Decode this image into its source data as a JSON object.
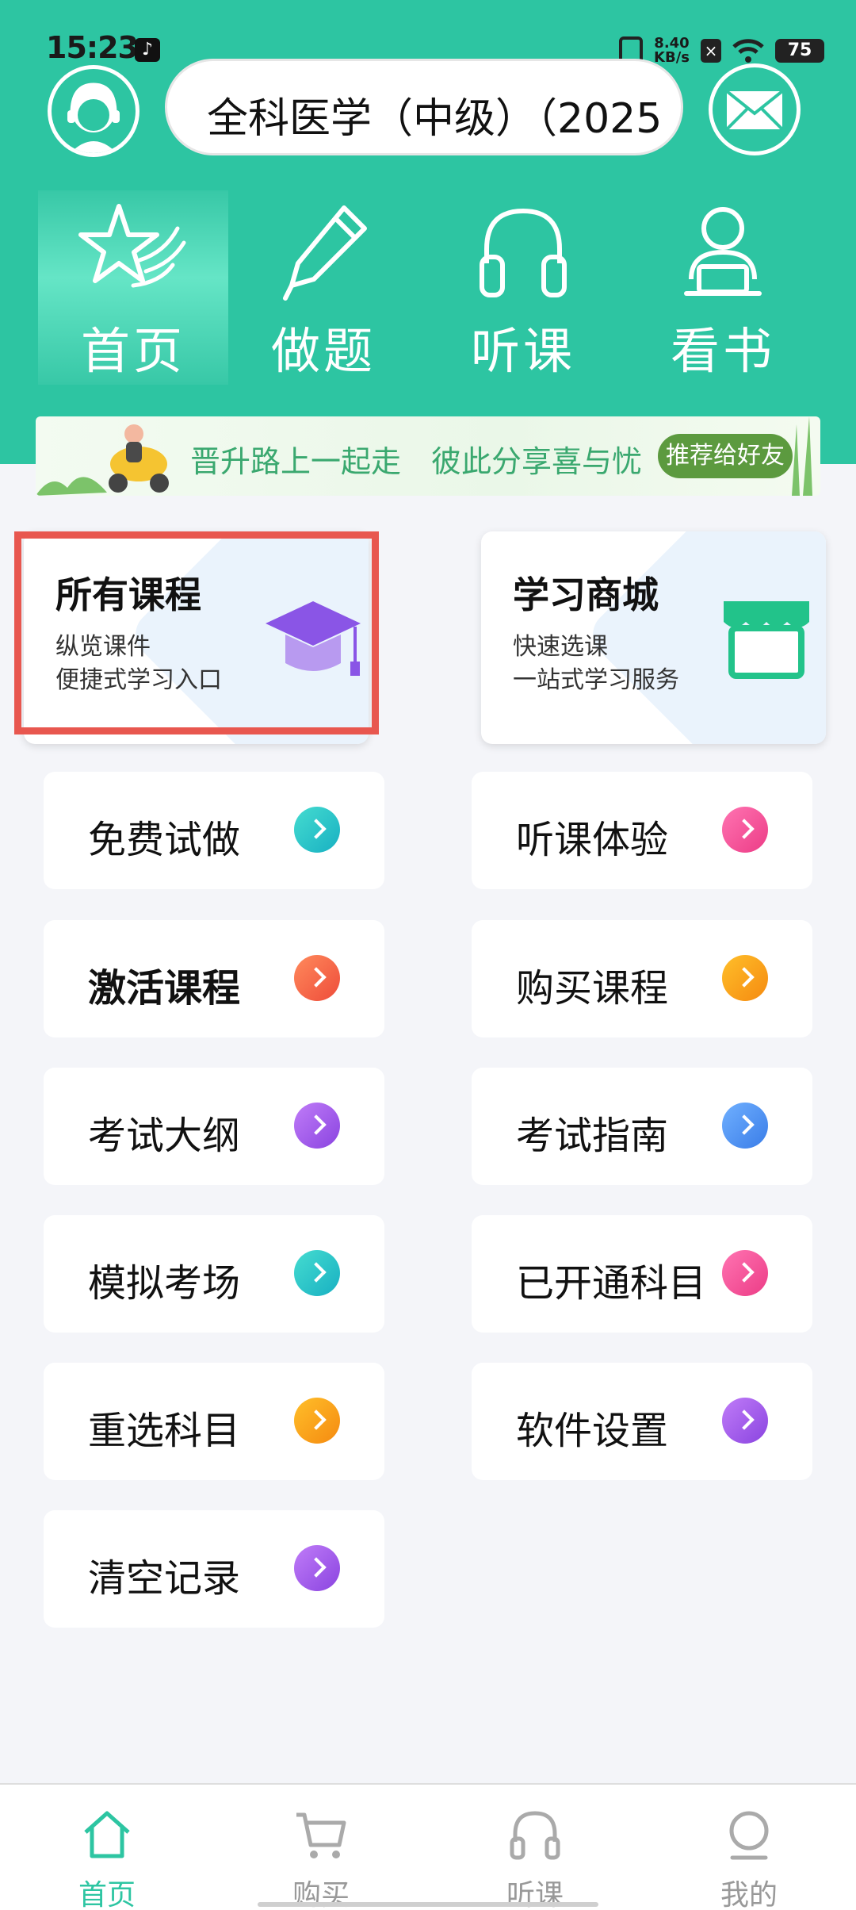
{
  "status_bar": {
    "time": "15:23",
    "tiktok_icon": "♪",
    "net_speed_value": "8.40",
    "net_speed_unit": "KB/s",
    "sim_icon": "×",
    "battery": "75"
  },
  "header": {
    "search_text": "全科医学（中级）（2025"
  },
  "top_tabs": [
    {
      "label": "首页",
      "icon": "star-icon",
      "active": true
    },
    {
      "label": "做题",
      "icon": "pencil-icon",
      "active": false
    },
    {
      "label": "听课",
      "icon": "headphones-icon",
      "active": false
    },
    {
      "label": "看书",
      "icon": "reader-icon",
      "active": false
    }
  ],
  "banner": {
    "text": "晋升路上一起走　彼此分享喜与忧",
    "button": "推荐给好友"
  },
  "big_cards": [
    {
      "title": "所有课程",
      "sub1": "纵览课件",
      "sub2": "便捷式学习入口",
      "icon": "graduation-cap-icon"
    },
    {
      "title": "学习商城",
      "sub1": "快速选课",
      "sub2": "一站式学习服务",
      "icon": "store-icon"
    }
  ],
  "menu": [
    {
      "label": "免费试做",
      "color": "#22c3c4"
    },
    {
      "label": "听课体验",
      "color": "#f0509a"
    },
    {
      "label": "激活课程",
      "color": "#f26b45"
    },
    {
      "label": "购买课程",
      "color": "#f7a11a"
    },
    {
      "label": "考试大纲",
      "color": "#a35ae8"
    },
    {
      "label": "考试指南",
      "color": "#4a8ff0"
    },
    {
      "label": "模拟考场",
      "color": "#22c3c4"
    },
    {
      "label": "已开通科目",
      "color": "#f0509a"
    },
    {
      "label": "重选科目",
      "color": "#f7a11a"
    },
    {
      "label": "软件设置",
      "color": "#a35ae8"
    },
    {
      "label": "清空记录",
      "color": "#a35ae8"
    }
  ],
  "bottom_nav": [
    {
      "label": "首页",
      "icon": "home-icon",
      "active": true
    },
    {
      "label": "购买",
      "icon": "cart-icon",
      "active": false
    },
    {
      "label": "听课",
      "icon": "headphones-icon",
      "active": false
    },
    {
      "label": "我的",
      "icon": "user-icon",
      "active": false
    }
  ],
  "colors": {
    "brand": "#2dc5a2",
    "highlight": "#e8574f"
  }
}
